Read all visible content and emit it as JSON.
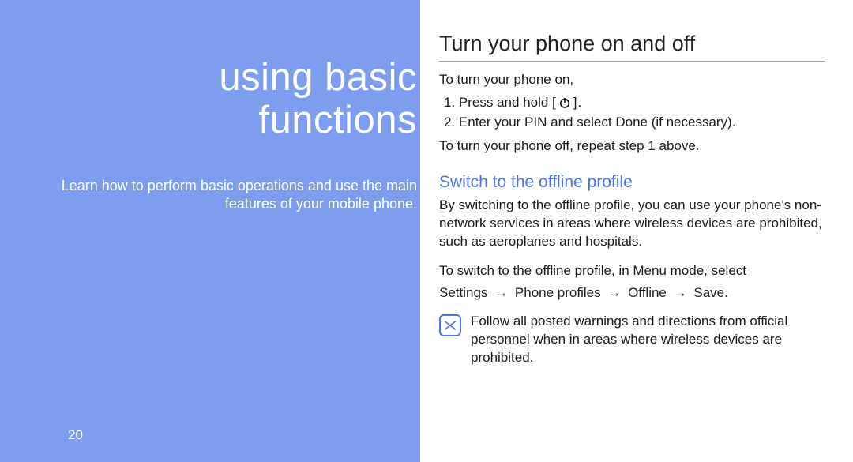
{
  "left": {
    "title_line1": "using basic",
    "title_line2": "functions",
    "subtitle": "Learn how to perform basic operations and use the main features of your mobile phone.",
    "page_number": "20"
  },
  "right": {
    "section1_title": "Turn your phone on and off",
    "intro_on": "To turn your phone on,",
    "step1_prefix": "1.  Press and hold [",
    "step1_suffix": "].",
    "step2": "2.  Enter your PIN and select Done (if necessary).",
    "intro_off": "To turn your phone off, repeat step 1 above.",
    "section2_title": "Switch to the offline profile",
    "para1": "By switching to the offline profile, you can use your phone's non-network services in areas where wireless devices are prohibited, such as aeroplanes and hospitals.",
    "para2_lead": "To switch to the offline profile, in Menu mode, select",
    "path_settings": "Settings",
    "path_profiles": "Phone profiles",
    "path_offline": "Offline",
    "path_save": "Save",
    "arrow": "→",
    "note": "Follow all posted warnings and directions from official personnel when in areas where wireless devices are prohibited."
  }
}
